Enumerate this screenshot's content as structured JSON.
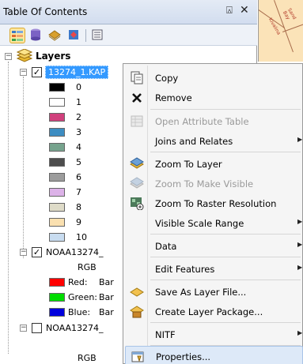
{
  "toc": {
    "title": "Table Of Contents",
    "pin_glyph": "⍓",
    "close_glyph": "✕",
    "layers_label": "Layers",
    "layer1": {
      "name": "13274_1.KAP",
      "legend": [
        {
          "label": "0",
          "color": "#000000"
        },
        {
          "label": "1",
          "color": "#ffffff"
        },
        {
          "label": "2",
          "color": "#d0407c"
        },
        {
          "label": "3",
          "color": "#3d8dc2"
        },
        {
          "label": "4",
          "color": "#76a38d"
        },
        {
          "label": "5",
          "color": "#4d4d4d"
        },
        {
          "label": "6",
          "color": "#9c9c9c"
        },
        {
          "label": "7",
          "color": "#dcb2e8"
        },
        {
          "label": "8",
          "color": "#dedbc8"
        },
        {
          "label": "9",
          "color": "#fae0b0"
        },
        {
          "label": "10",
          "color": "#c8dcf0"
        }
      ]
    },
    "layer2": {
      "name": "NOAA13274_",
      "type_label": "RGB",
      "bands": [
        {
          "label": "Red:",
          "value": "Bar",
          "color": "#ff0000"
        },
        {
          "label": "Green:",
          "value": "Bar",
          "color": "#00dd00"
        },
        {
          "label": "Blue:",
          "value": "Bar",
          "color": "#0000dd"
        }
      ]
    },
    "layer3": {
      "name": "NOAA13274_",
      "type_label": "RGB"
    }
  },
  "menu": {
    "items": [
      {
        "label": "Copy",
        "icon": "copy-icon"
      },
      {
        "label": "Remove",
        "icon": "remove-icon"
      },
      {
        "label": "Open Attribute Table",
        "icon": "table-icon",
        "disabled": true
      },
      {
        "label": "Joins and Relates",
        "submenu": true
      },
      {
        "label": "Zoom To Layer",
        "icon": "zoom-to-layer-icon"
      },
      {
        "label": "Zoom To Make Visible",
        "icon": "zoom-visible-icon",
        "disabled": true
      },
      {
        "label": "Zoom To Raster Resolution",
        "icon": "zoom-raster-icon"
      },
      {
        "label": "Visible Scale Range",
        "submenu": true
      },
      {
        "label": "Data",
        "submenu": true
      },
      {
        "label": "Edit Features",
        "submenu": true
      },
      {
        "label": "Save As Layer File...",
        "icon": "save-layer-icon"
      },
      {
        "label": "Create Layer Package...",
        "icon": "layer-package-icon"
      },
      {
        "label": "NITF",
        "submenu": true
      },
      {
        "label": "Properties...",
        "icon": "properties-icon",
        "highlighted": true
      }
    ],
    "submenu_arrow": "▶"
  },
  "map": {
    "labels": [
      "Kivalina",
      "Sand Bay"
    ]
  },
  "colors": {
    "selection_bg": "#3399ff",
    "menu_highlight": "#dde9f8",
    "map_bg": "#fbe3b8"
  }
}
